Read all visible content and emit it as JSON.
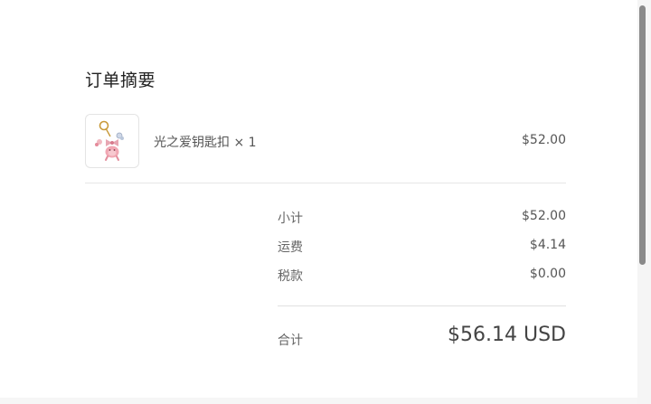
{
  "order_summary": {
    "title": "订单摘要",
    "item": {
      "name": "光之爱钥匙扣 × 1",
      "price": "$52.00",
      "thumbnail_icon": "keychain-product-image"
    },
    "rows": [
      {
        "label": "小计",
        "value": "$52.00"
      },
      {
        "label": "运费",
        "value": "$4.14"
      },
      {
        "label": "税款",
        "value": "$0.00"
      }
    ],
    "total": {
      "label": "合计",
      "value": "$56.14 USD"
    }
  },
  "colors": {
    "divider": "#e6e6e6",
    "text_primary": "#222222",
    "text_secondary": "#555555",
    "scrollbar_thumb": "#8a8a8a"
  }
}
